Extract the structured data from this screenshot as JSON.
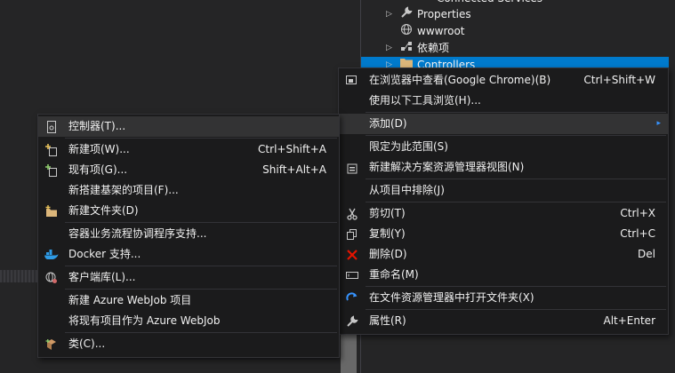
{
  "solution_explorer": {
    "items": [
      {
        "label": "Connected Services",
        "icon": "connected-services-icon",
        "arrow": false
      },
      {
        "label": "Properties",
        "icon": "wrench-icon",
        "arrow": true
      },
      {
        "label": "wwwroot",
        "icon": "globe-icon",
        "arrow": false
      },
      {
        "label": "依赖项",
        "icon": "dependencies-icon",
        "arrow": true
      },
      {
        "label": "Controllers",
        "icon": "folder-icon",
        "arrow": true,
        "selected": true
      }
    ]
  },
  "context_menu": {
    "items": [
      {
        "label": "在浏览器中查看(Google Chrome)(B)",
        "shortcut": "Ctrl+Shift+W",
        "icon": "browser-view-icon"
      },
      {
        "label": "使用以下工具浏览(H)...",
        "shortcut": "",
        "icon": ""
      },
      {
        "label": "添加(D)",
        "shortcut": "",
        "icon": "",
        "submenu": true,
        "highlighted": true
      },
      {
        "label": "限定为此范围(S)",
        "shortcut": "",
        "icon": ""
      },
      {
        "label": "新建解决方案资源管理器视图(N)",
        "shortcut": "",
        "icon": "new-view-icon"
      },
      {
        "label": "从项目中排除(J)",
        "shortcut": "",
        "icon": ""
      },
      {
        "label": "剪切(T)",
        "shortcut": "Ctrl+X",
        "icon": "scissors-icon"
      },
      {
        "label": "复制(Y)",
        "shortcut": "Ctrl+C",
        "icon": "copy-icon"
      },
      {
        "label": "删除(D)",
        "shortcut": "Del",
        "icon": "delete-x-icon"
      },
      {
        "label": "重命名(M)",
        "shortcut": "",
        "icon": "rename-icon"
      },
      {
        "label": "在文件资源管理器中打开文件夹(X)",
        "shortcut": "",
        "icon": "refresh-open-icon"
      },
      {
        "label": "属性(R)",
        "shortcut": "Alt+Enter",
        "icon": "wrench-icon"
      }
    ]
  },
  "add_submenu": {
    "items": [
      {
        "label": "控制器(T)...",
        "shortcut": "",
        "icon": "controller-icon",
        "highlighted": true
      },
      {
        "label": "新建项(W)...",
        "shortcut": "Ctrl+Shift+A",
        "icon": "new-item-icon"
      },
      {
        "label": "现有项(G)...",
        "shortcut": "Shift+Alt+A",
        "icon": "existing-item-icon"
      },
      {
        "label": "新搭建基架的项目(F)...",
        "shortcut": "",
        "icon": ""
      },
      {
        "label": "新建文件夹(D)",
        "shortcut": "",
        "icon": "new-folder-icon"
      },
      {
        "label": "容器业务流程协调程序支持...",
        "shortcut": "",
        "icon": ""
      },
      {
        "label": "Docker 支持...",
        "shortcut": "",
        "icon": "docker-icon"
      },
      {
        "label": "客户端库(L)...",
        "shortcut": "",
        "icon": "client-library-icon"
      },
      {
        "label": "新建 Azure WebJob 项目",
        "shortcut": "",
        "icon": ""
      },
      {
        "label": "将现有项目作为 Azure WebJob",
        "shortcut": "",
        "icon": ""
      },
      {
        "label": "类(C)...",
        "shortcut": "",
        "icon": "class-icon"
      }
    ]
  }
}
